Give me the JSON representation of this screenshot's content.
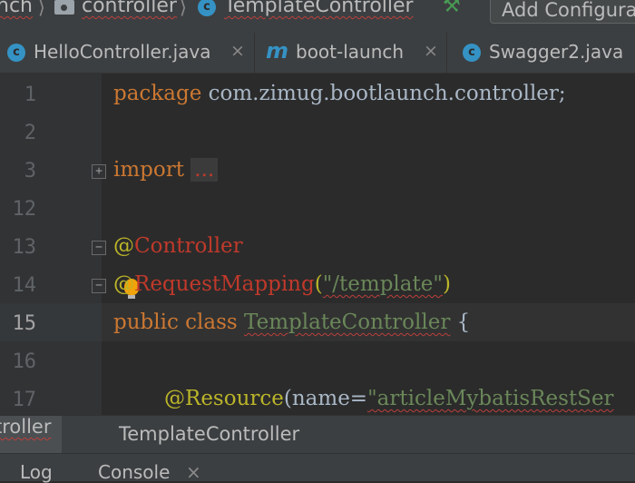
{
  "breadcrumb": {
    "items": [
      "nch",
      "controller",
      "TemplateController"
    ],
    "separator": "⟩",
    "run_config_label": "Add Configura"
  },
  "tabs": [
    {
      "label": "HelloController.java",
      "icon": "c-class-icon",
      "close": "×"
    },
    {
      "label": "boot-launch",
      "icon": "maven-m-icon",
      "close": "×"
    },
    {
      "label": "Swagger2.java",
      "icon": "c-class-icon"
    }
  ],
  "editor": {
    "current_line": "15",
    "lines": [
      {
        "num": "1",
        "parts": [
          "package",
          " com.zimug.bootlaunch.controller;"
        ]
      },
      {
        "num": "2"
      },
      {
        "num": "3",
        "parts": [
          "import",
          "..."
        ]
      },
      {
        "num": "12"
      },
      {
        "num": "13",
        "parts": [
          "@",
          "Controller"
        ]
      },
      {
        "num": "14",
        "parts": [
          "@",
          "RequestMapping",
          "(",
          "\"/template\"",
          ")"
        ]
      },
      {
        "num": "15",
        "parts": [
          "public class",
          " ",
          "TemplateController",
          " {"
        ]
      },
      {
        "num": "16"
      },
      {
        "num": "17",
        "parts": [
          "@",
          "Resource",
          "(name=",
          "\"articleMybatisRestSer"
        ]
      }
    ]
  },
  "run_panel": {
    "left_label": "troller",
    "tab_label": "TemplateController"
  },
  "bottom_tabs": {
    "log": "Log",
    "console": "Console",
    "console_close": "×"
  },
  "colors": {
    "keyword": "#cc7832",
    "annotation": "#bbb529",
    "string": "#6a8759",
    "error_underline": "#bc3f3c",
    "background": "#2b2b2b"
  }
}
